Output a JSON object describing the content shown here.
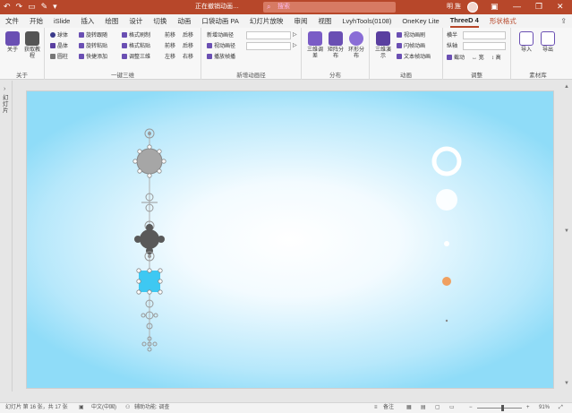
{
  "titlebar": {
    "undo_icon": "undo-icon",
    "redo_icon": "redo-icon",
    "document_title": "正在撤销动画…",
    "search_placeholder": "搜索",
    "user_name": "明 旌",
    "accent": "#b7472a"
  },
  "tabs": [
    {
      "label": "文件"
    },
    {
      "label": "开始"
    },
    {
      "label": "iSlide"
    },
    {
      "label": "插入"
    },
    {
      "label": "绘图"
    },
    {
      "label": "设计"
    },
    {
      "label": "切换"
    },
    {
      "label": "动画"
    },
    {
      "label": "口袋动画 PA"
    },
    {
      "label": "幻灯片放映"
    },
    {
      "label": "审阅"
    },
    {
      "label": "视图"
    },
    {
      "label": "LvyhTools(0108)"
    },
    {
      "label": "OneKey Lite"
    },
    {
      "label": "ThreeD 4",
      "active": true
    },
    {
      "label": "形状格式",
      "red": true
    }
  ],
  "ribbon": {
    "about": {
      "btn1": "关于",
      "btn2": "获取教程",
      "label": "关于"
    },
    "onekey3d": {
      "col1": [
        "球体",
        "晶体",
        "圆柱"
      ],
      "col2": [
        "旋转跟随",
        "旋转粘贴",
        "快捷添加"
      ],
      "col3": [
        "格式刷制",
        "格式粘贴",
        "调整三维"
      ],
      "col4": [
        "前移",
        "前移",
        "左移"
      ],
      "col5": [
        "后移",
        "后移",
        "右移"
      ],
      "label": "一键三维"
    },
    "motionpath": {
      "row1": "新增动画径",
      "row2": "视动画径",
      "row3": "播放帧播",
      "label": "新增动画径"
    },
    "distribute": {
      "btns": [
        "三维调差",
        "矩阵分布",
        "环形分布"
      ],
      "label": "分布"
    },
    "animation": {
      "btn": "三维演示",
      "items": [
        "视动画刷",
        "闪帧动画",
        "文本帧动画"
      ],
      "label": "动画"
    },
    "adjust": {
      "field1": "横半",
      "field2": "纵轴",
      "items": [
        "截动",
        "宽",
        "高"
      ],
      "label": "调整"
    },
    "export": {
      "btns": [
        "导入",
        "导出"
      ],
      "label": "素材库"
    }
  },
  "sidepanel": {
    "label": "幻灯片"
  },
  "statusbar": {
    "slide_info": "幻灯片 第 16 张，共 17 张",
    "language": "中文(中国)",
    "accessibility": "辅助功能: 调查",
    "notes": "备注",
    "zoom": "91%"
  },
  "colors": {
    "node_gray": "#a6a6a6",
    "node_dark": "#595959",
    "node_blue": "#3ec8f2",
    "dot_orange": "#f0a060"
  }
}
